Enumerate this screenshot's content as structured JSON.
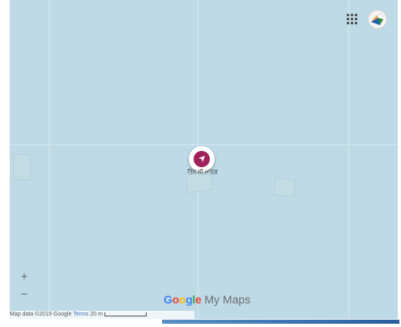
{
  "map": {
    "background_color": "#bddae6"
  },
  "header": {
    "apps_icon": "apps-grid-icon",
    "avatar_icon": "user-avatar-icon"
  },
  "marker": {
    "icon": "pin-marker-icon",
    "color": "#a0205c",
    "label": "ਤਿੰਨ ਸੀ ਮਾਰਗ"
  },
  "zoom": {
    "in_label": "+",
    "out_label": "−"
  },
  "brand": {
    "google": "Google",
    "maps": " My Maps",
    "g_colors": [
      "#4285f4",
      "#ea4335",
      "#fbbc05",
      "#4285f4",
      "#34a853",
      "#ea4335"
    ]
  },
  "footer": {
    "attribution": "Map data ©2019 Google",
    "terms": "Terms",
    "scale": "20 m"
  }
}
